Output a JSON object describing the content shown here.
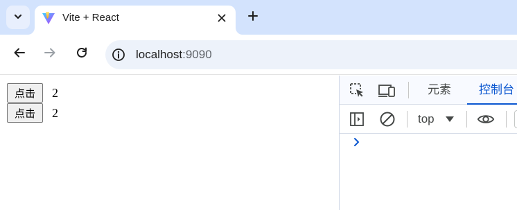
{
  "tab": {
    "title": "Vite + React",
    "favicon": "vite-logo-icon",
    "close_icon": "close-icon"
  },
  "tabstrip": {
    "search_tabs_icon": "chevron-down-icon",
    "new_tab_icon": "plus-icon"
  },
  "toolbar": {
    "back_icon": "arrow-left-icon",
    "forward_icon": "arrow-right-icon",
    "reload_icon": "reload-icon",
    "site_info_icon": "info-icon",
    "url_host": "localhost",
    "url_port": ":9090"
  },
  "page": {
    "rows": [
      {
        "button_label": "点击",
        "count": "2"
      },
      {
        "button_label": "点击",
        "count": "2"
      }
    ]
  },
  "devtools": {
    "inspect_icon": "inspect-element-icon",
    "device_icon": "device-toolbar-icon",
    "tabs": {
      "elements": "元素",
      "console": "控制台"
    },
    "sidebar_icon": "sidebar-toggle-icon",
    "clear_icon": "clear-console-icon",
    "context": "top",
    "live_expression_icon": "eye-icon",
    "prompt_icon": "chevron-right-icon"
  },
  "colors": {
    "tabstrip_bg": "#d3e3fd",
    "omnibox_bg": "#edf2fa",
    "devtools_accent": "#0b57d0"
  }
}
